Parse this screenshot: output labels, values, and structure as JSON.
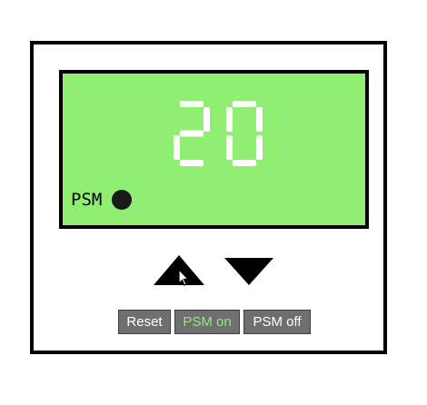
{
  "display": {
    "value": "20",
    "digit_color": "#ffffff",
    "background": "#90ee73"
  },
  "psm": {
    "label": "PSM",
    "led_color": "#1a1a1a"
  },
  "controls": {
    "up_icon": "triangle-up-icon",
    "down_icon": "triangle-down-icon"
  },
  "buttons": {
    "reset": "Reset",
    "psm_on": "PSM on",
    "psm_off": "PSM off",
    "psm_on_color": "#90ee73",
    "default_text_color": "#ffffff"
  }
}
